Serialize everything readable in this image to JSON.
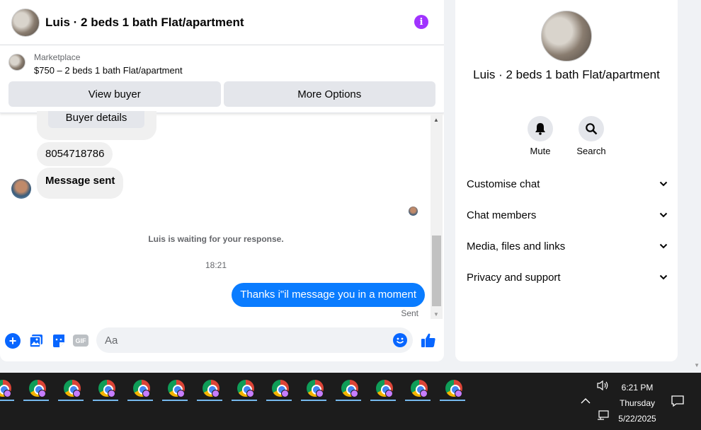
{
  "chat": {
    "title": "Luis · 2 beds 1 bath Flat/apartment",
    "listing": {
      "label": "Marketplace",
      "price_title": "$750 – 2 beds 1 bath Flat/apartment",
      "view_buyer": "View buyer",
      "more_options": "More Options"
    },
    "messages": {
      "buyer_details": "Buyer details",
      "phone": "8054718786",
      "message_sent": "Message sent",
      "waiting": "Luis is waiting for your response.",
      "timestamp": "18:21",
      "outgoing": "Thanks i\"il message you in a moment",
      "status": "Sent"
    },
    "composer": {
      "placeholder": "Aa",
      "gif_label": "GIF"
    }
  },
  "info_panel": {
    "title": "Luis · 2 beds 1 bath Flat/apartment",
    "mute_label": "Mute",
    "search_label": "Search",
    "sections": [
      "Customise chat",
      "Chat members",
      "Media, files and links",
      "Privacy and support"
    ]
  },
  "taskbar": {
    "app_count": 14,
    "time": "6:21 PM",
    "day": "Thursday",
    "date": "5/22/2025"
  },
  "colors": {
    "accent": "#0866ff",
    "outgoing_bubble": "#0a7cff",
    "info_button": "#a033ff"
  }
}
